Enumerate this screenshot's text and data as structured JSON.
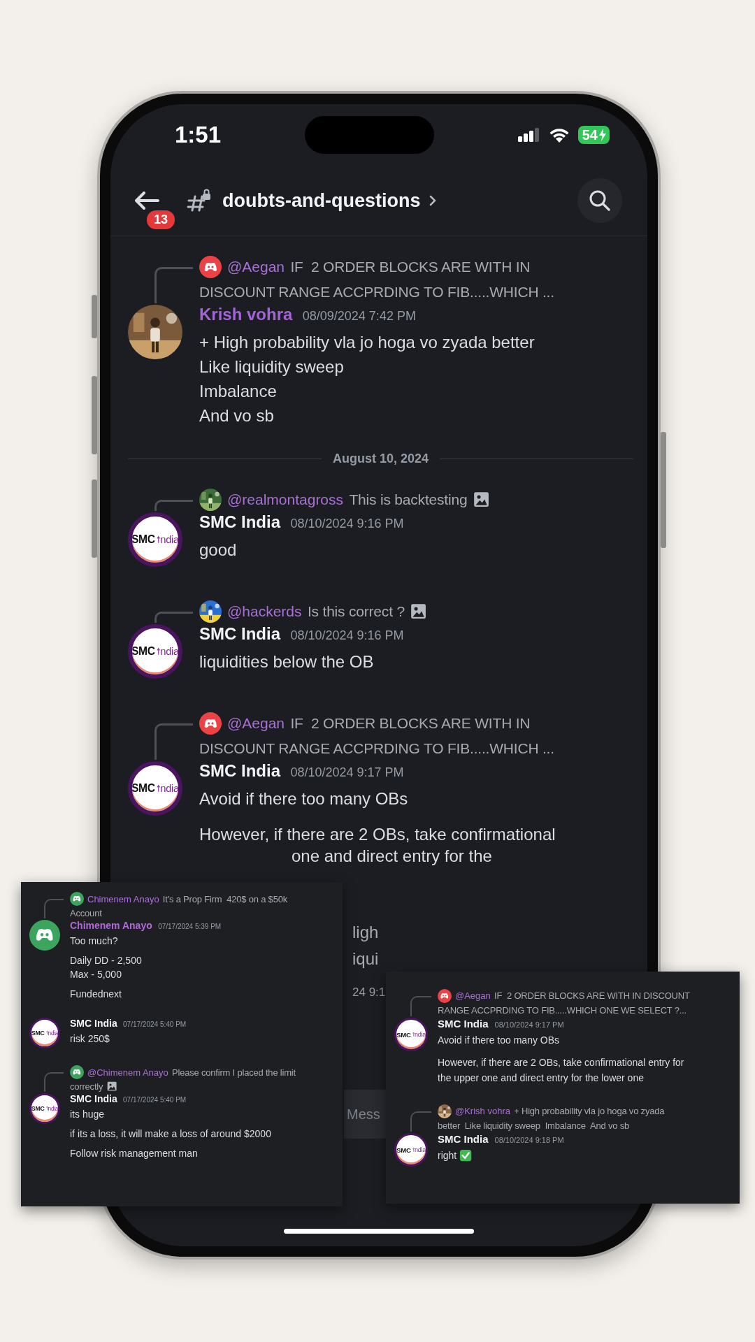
{
  "status_bar": {
    "time": "1:51",
    "battery": "54",
    "charging": true
  },
  "header": {
    "back_badge": "13",
    "channel": "doubts-and-questions"
  },
  "messages": [
    {
      "kind": "message",
      "reply": {
        "avatar": {
          "kind": "discord",
          "color": "#ed4245"
        },
        "mention": "@Aegan",
        "lines": [
          "IF  2 ORDER BLOCKS ARE WITH IN",
          "DISCOUNT RANGE ACCPRDING TO FIB.....WHICH ..."
        ],
        "image": false
      },
      "avatar": {
        "kind": "picture"
      },
      "author": "Krish vohra",
      "color": "#a463d6",
      "timestamp": "08/09/2024 7:42 PM",
      "paragraphs": [
        [
          "+ High probability vla jo hoga vo zyada better",
          "Like liquidity sweep",
          "Imbalance",
          "And vo sb"
        ]
      ]
    },
    {
      "kind": "date_divider",
      "label": "August 10, 2024"
    },
    {
      "kind": "message",
      "reply": {
        "avatar": {
          "kind": "picture"
        },
        "mention": "@realmontagross",
        "lines": [
          "This is backtesting"
        ],
        "image": true
      },
      "avatar": {
        "kind": "logo",
        "label": "SMC",
        "sub": "ndia"
      },
      "author": "SMC India",
      "color": "#f2f3f5",
      "timestamp": "08/10/2024 9:16 PM",
      "paragraphs": [
        [
          "good"
        ]
      ]
    },
    {
      "kind": "message",
      "reply": {
        "avatar": {
          "kind": "picture"
        },
        "mention": "@hackerds",
        "lines": [
          "Is this correct ?"
        ],
        "image": true
      },
      "avatar": {
        "kind": "logo",
        "label": "SMC",
        "sub": "ndia"
      },
      "author": "SMC India",
      "color": "#f2f3f5",
      "timestamp": "08/10/2024 9:16 PM",
      "paragraphs": [
        [
          "liquidities below the OB"
        ]
      ]
    },
    {
      "kind": "message",
      "reply": {
        "avatar": {
          "kind": "discord",
          "color": "#ed4245"
        },
        "mention": "@Aegan",
        "lines": [
          "IF  2 ORDER BLOCKS ARE WITH IN",
          "DISCOUNT RANGE ACCPRDING TO FIB.....WHICH ..."
        ],
        "image": false
      },
      "avatar": {
        "kind": "logo",
        "label": "SMC",
        "sub": "ndia"
      },
      "author": "SMC India",
      "color": "#f2f3f5",
      "timestamp": "08/10/2024 9:17 PM",
      "paragraphs": [
        [
          "Avoid if there too many OBs"
        ],
        [
          "However, if there are 2 OBs, take confirmational"
        ]
      ]
    }
  ],
  "hidden_fragments": {
    "continued_line": "one and direct entry for the",
    "reply_lines": [
      "ligh",
      "iqui"
    ],
    "timestamp": "24 9:1"
  },
  "composer": {
    "placeholder": "Mess"
  },
  "cards": [
    {
      "messages": [
        {
          "kind": "message",
          "reply": {
            "avatar": {
              "kind": "discord",
              "color": "#3ba55d"
            },
            "mention": "Chimenem Anayo",
            "lines": [
              "It's a Prop Firm  420$ on a $50k",
              "Account"
            ],
            "image": false
          },
          "avatar": {
            "kind": "discord",
            "color": "#3ba55d"
          },
          "author": "Chimenem Anayo",
          "color": "#b26ad8",
          "timestamp": "07/17/2024 5:39 PM",
          "paragraphs": [
            [
              "Too much?"
            ],
            [
              "Daily DD - 2,500",
              "Max - 5,000"
            ],
            [
              "Fundednext"
            ]
          ]
        },
        {
          "kind": "message",
          "avatar": {
            "kind": "logo",
            "label": "SMC",
            "sub": "ndia"
          },
          "author": "SMC India",
          "color": "#f2f3f5",
          "timestamp": "07/17/2024 5:40 PM",
          "paragraphs": [
            [
              "risk 250$"
            ]
          ]
        },
        {
          "kind": "message",
          "reply": {
            "avatar": {
              "kind": "discord",
              "color": "#3ba55d"
            },
            "mention": "@Chimenem Anayo",
            "lines": [
              "Please confirm I placed the limit",
              "correctly"
            ],
            "image": true
          },
          "avatar": {
            "kind": "logo",
            "label": "SMC",
            "sub": "ndia"
          },
          "author": "SMC India",
          "color": "#f2f3f5",
          "timestamp": "07/17/2024 5:40 PM",
          "paragraphs": [
            [
              "its huge"
            ],
            [
              "if its a loss, it will make a loss of around $2000"
            ],
            [
              "Follow risk management man"
            ]
          ]
        }
      ]
    },
    {
      "messages": [
        {
          "kind": "message",
          "reply": {
            "avatar": {
              "kind": "discord",
              "color": "#ed4245"
            },
            "mention": "@Aegan",
            "lines": [
              "IF  2 ORDER BLOCKS ARE WITH IN DISCOUNT",
              "RANGE ACCPRDING TO FIB.....WHICH ONE WE SELECT ?..."
            ],
            "image": false
          },
          "avatar": {
            "kind": "logo",
            "label": "SMC",
            "sub": "ndia"
          },
          "author": "SMC India",
          "color": "#f2f3f5",
          "timestamp": "08/10/2024 9:17 PM",
          "paragraphs": [
            [
              "Avoid if there too many OBs"
            ],
            [
              "However, if there are 2 OBs, take confirmational entry for",
              "the upper one and direct entry for the lower one"
            ]
          ]
        },
        {
          "kind": "message",
          "reply": {
            "avatar": {
              "kind": "picture"
            },
            "mention": "@Krish vohra",
            "lines": [
              "+ High probability vla jo hoga vo zyada",
              "better  Like liquidity sweep  Imbalance  And vo sb"
            ],
            "image": false
          },
          "avatar": {
            "kind": "logo",
            "label": "SMC",
            "sub": "ndia"
          },
          "author": "SMC India",
          "color": "#f2f3f5",
          "timestamp": "08/10/2024 9:18 PM",
          "paragraphs": [
            [
              "right"
            ]
          ],
          "checkmark": true
        }
      ]
    }
  ]
}
